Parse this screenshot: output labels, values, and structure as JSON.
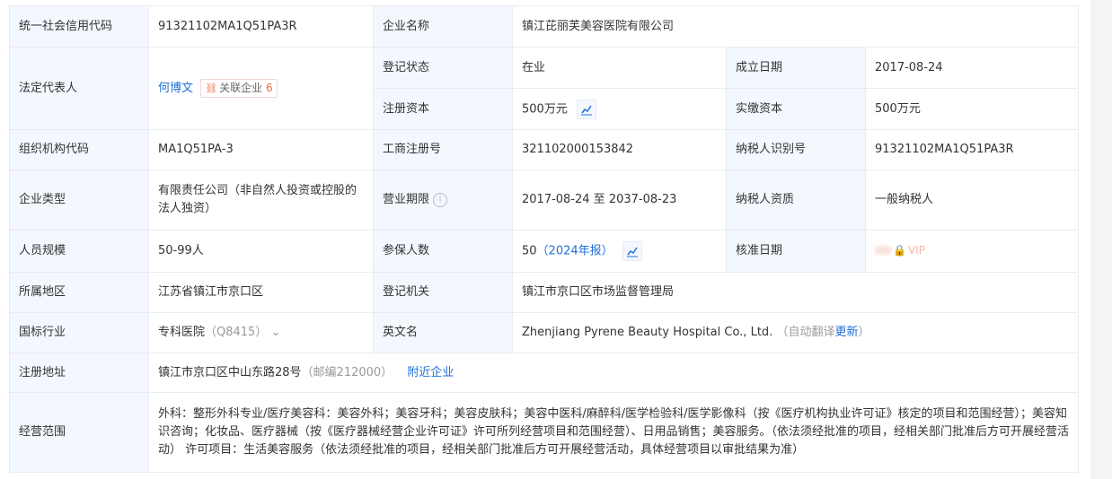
{
  "rows": {
    "credit_code": {
      "label": "统一社会信用代码",
      "value": "91321102MA1Q51PA3R"
    },
    "company_name": {
      "label": "企业名称",
      "value": "镇江芘丽芙美容医院有限公司"
    },
    "legal_rep": {
      "label": "法定代表人",
      "name": "何博文",
      "related_label": "关联企业",
      "related_count": "6"
    },
    "reg_status": {
      "label": "登记状态",
      "value": "在业"
    },
    "found_date": {
      "label": "成立日期",
      "value": "2017-08-24"
    },
    "reg_capital": {
      "label": "注册资本",
      "value": "500万元"
    },
    "paid_capital": {
      "label": "实缴资本",
      "value": "500万元"
    },
    "org_code": {
      "label": "组织机构代码",
      "value": "MA1Q51PA-3"
    },
    "biz_reg_no": {
      "label": "工商注册号",
      "value": "321102000153842"
    },
    "taxpayer_id": {
      "label": "纳税人识别号",
      "value": "91321102MA1Q51PA3R"
    },
    "company_type": {
      "label": "企业类型",
      "value": "有限责任公司（非自然人投资或控股的法人独资）"
    },
    "biz_term": {
      "label": "营业期限",
      "value": "2017-08-24 至 2037-08-23"
    },
    "taxpayer_qual": {
      "label": "纳税人资质",
      "value": "一般纳税人"
    },
    "staff_size": {
      "label": "人员规模",
      "value": "50-99人"
    },
    "insured": {
      "label": "参保人数",
      "value": "50",
      "report": "（2024年报）"
    },
    "approval_date": {
      "label": "核准日期",
      "vip": "VIP"
    },
    "region": {
      "label": "所属地区",
      "value": "江苏省镇江市京口区"
    },
    "reg_authority": {
      "label": "登记机关",
      "value": "镇江市京口区市场监督管理局"
    },
    "industry": {
      "label": "国标行业",
      "value": "专科医院",
      "code": "（Q8415）"
    },
    "english_name": {
      "label": "英文名",
      "value": "Zhenjiang Pyrene Beauty Hospital Co., Ltd.",
      "auto_prefix": "（自动翻译",
      "update_link": "更新",
      "auto_suffix": "）"
    },
    "reg_address": {
      "label": "注册地址",
      "value": "镇江市京口区中山东路28号",
      "postcode": "（邮编212000）",
      "nearby_link": "附近企业"
    },
    "biz_scope": {
      "label": "经营范围",
      "value": "外科：整形外科专业/医疗美容科：美容外科；美容牙科；美容皮肤科；美容中医科/麻醉科/医学检验科/医学影像科（按《医疗机构执业许可证》核定的项目和范围经营）；美容知识咨询；化妆品、医疗器械（按《医疗器械经营企业许可证》许可所列经营项目和范围经营）、日用品销售；美容服务。（依法须经批准的项目，经相关部门批准后方可开展经营活动） 许可项目：生活美容服务（依法须经批准的项目，经相关部门批准后方可开展经营活动，具体经营项目以审批结果为准）"
    }
  },
  "icons": {
    "chart": "trend-chart-icon",
    "info": "info-circle-icon",
    "chevron": "chevron-down-icon",
    "lock": "lock-icon",
    "related": "network-icon"
  },
  "colors": {
    "label_bg": "#f3f7fe",
    "link": "#1e6fd9",
    "accent": "#f36a3e",
    "border": "#e8ebf0"
  }
}
